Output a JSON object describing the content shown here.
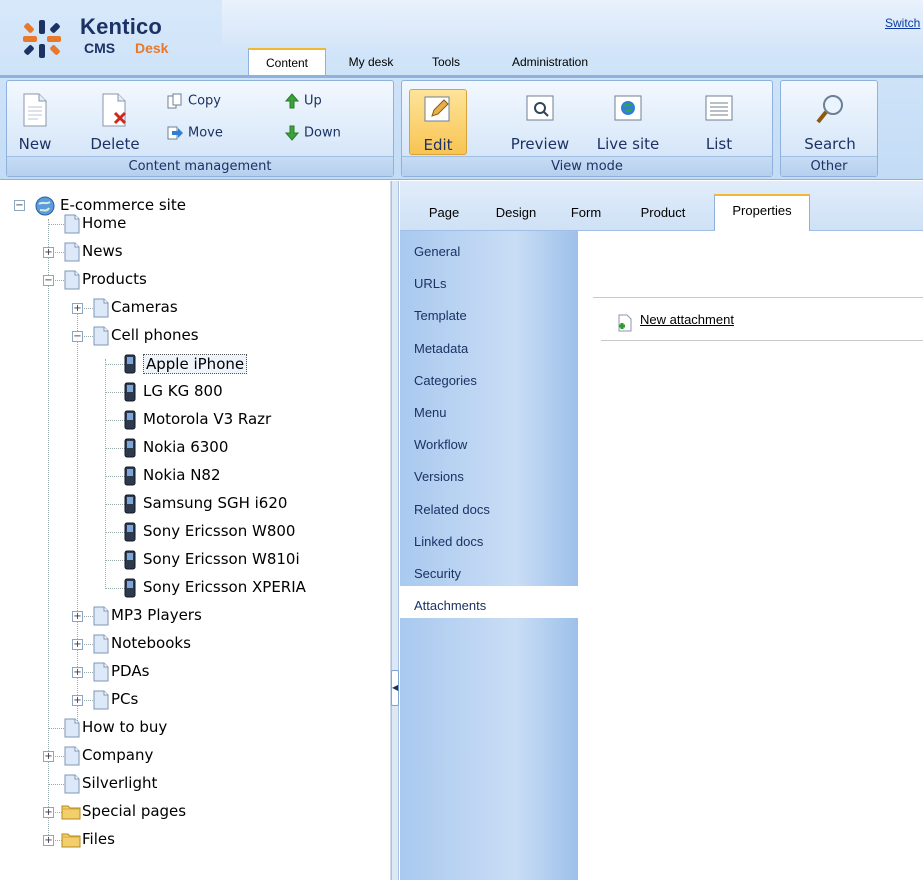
{
  "app": {
    "brand": "Kentico",
    "product_word_1": "CMS",
    "product_word_2": "Desk",
    "switch_link": "Switch"
  },
  "main_tabs": [
    "Content",
    "My desk",
    "Tools",
    "Administration"
  ],
  "ribbon": {
    "content_management": {
      "label": "Content management",
      "new": "New",
      "delete": "Delete",
      "copy": "Copy",
      "move": "Move",
      "up": "Up",
      "down": "Down"
    },
    "view_mode": {
      "label": "View mode",
      "edit": "Edit",
      "preview": "Preview",
      "live_site": "Live site",
      "list": "List"
    },
    "other": {
      "label": "Other",
      "search": "Search"
    }
  },
  "tree": {
    "root": "E-commerce site",
    "home": "Home",
    "news": "News",
    "products": "Products",
    "cameras": "Cameras",
    "cell_phones": "Cell phones",
    "phones": [
      "Apple iPhone",
      "LG KG 800",
      "Motorola V3 Razr",
      "Nokia 6300",
      "Nokia N82",
      "Samsung SGH i620",
      "Sony Ericsson W800",
      "Sony Ericsson W810i",
      "Sony Ericsson XPERIA"
    ],
    "mp3": "MP3 Players",
    "notebooks": "Notebooks",
    "pdas": "PDAs",
    "pcs": "PCs",
    "how_to_buy": "How to buy",
    "company": "Company",
    "silverlight": "Silverlight",
    "special_pages": "Special pages",
    "files": "Files"
  },
  "sub_tabs": [
    "Page",
    "Design",
    "Form",
    "Product",
    "Properties"
  ],
  "vertical_tabs": [
    "General",
    "URLs",
    "Template",
    "Metadata",
    "Categories",
    "Menu",
    "Workflow",
    "Versions",
    "Related docs",
    "Linked docs",
    "Security",
    "Attachments"
  ],
  "content": {
    "new_attachment": "New attachment"
  }
}
